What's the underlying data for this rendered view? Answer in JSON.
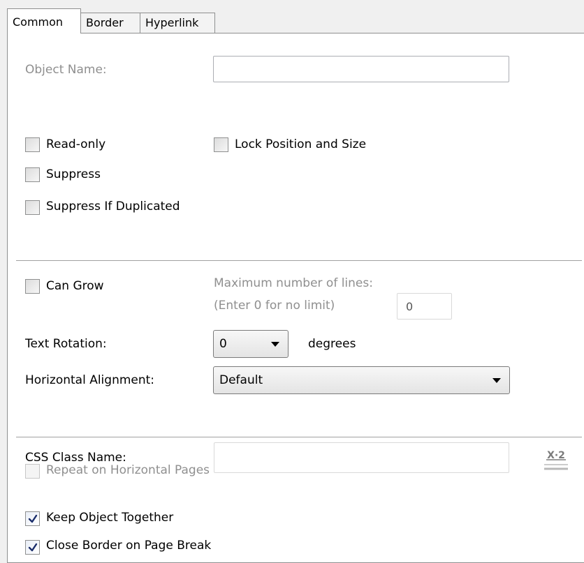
{
  "tabs": [
    {
      "label": "Common",
      "active": true
    },
    {
      "label": "Border",
      "active": false
    },
    {
      "label": "Hyperlink",
      "active": false
    }
  ],
  "object_name": {
    "label": "Object Name:",
    "value": ""
  },
  "checkboxes": {
    "read_only": {
      "label": "Read-only",
      "checked": false
    },
    "lock_position": {
      "label": "Lock Position and Size",
      "checked": false
    },
    "suppress": {
      "label": "Suppress",
      "checked": false
    },
    "suppress_if_duplicated": {
      "label": "Suppress If Duplicated",
      "checked": false
    },
    "can_grow": {
      "label": "Can Grow",
      "checked": false
    },
    "repeat_horizontal": {
      "label": "Repeat on Horizontal Pages",
      "checked": false,
      "disabled": true
    },
    "keep_together": {
      "label": "Keep Object Together",
      "checked": true
    },
    "close_border": {
      "label": "Close Border on Page Break",
      "checked": true
    }
  },
  "max_lines": {
    "label": "Maximum number of lines:",
    "hint": "(Enter 0 for no limit)",
    "value": "0"
  },
  "text_rotation": {
    "label": "Text Rotation:",
    "value": "0",
    "unit": "degrees"
  },
  "horizontal_alignment": {
    "label": "Horizontal Alignment:",
    "value": "Default"
  },
  "css_class": {
    "label": "CSS Class Name:",
    "value": ""
  },
  "formula_button": {
    "icon": "formula-x2-icon",
    "text": "X·2"
  }
}
